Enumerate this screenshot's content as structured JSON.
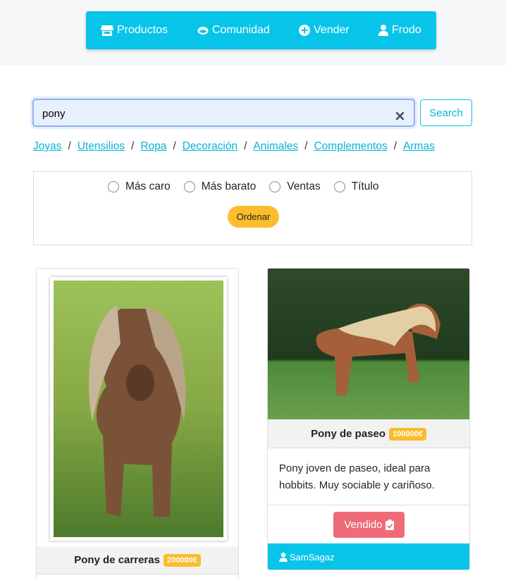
{
  "nav": {
    "items": [
      {
        "label": "Productos",
        "icon": "store-icon"
      },
      {
        "label": "Comunidad",
        "icon": "ring-icon"
      },
      {
        "label": "Vender",
        "icon": "plus-circle-icon"
      },
      {
        "label": "Frodo",
        "icon": "user-icon"
      }
    ]
  },
  "search": {
    "value": "pony",
    "button_label": "Search"
  },
  "categories": [
    "Joyas",
    "Utensilios",
    "Ropa",
    "Decoración",
    "Animales",
    "Complementos",
    "Armas"
  ],
  "sort": {
    "options": [
      "Más caro",
      "Más barato",
      "Ventas",
      "Título"
    ],
    "button_label": "Ordenar"
  },
  "products": [
    {
      "title": "Pony de carreras",
      "price": "200000€"
    },
    {
      "title": "Pony de paseo",
      "price": "100000€",
      "description": "Pony joven de paseo, ideal para hobbits. Muy sociable y cariñoso.",
      "status_label": "Vendido",
      "seller": "SamSagaz"
    }
  ],
  "colors": {
    "primary": "#08c4e9",
    "accent": "#fbbd2e",
    "sold": "#ef6b78"
  }
}
